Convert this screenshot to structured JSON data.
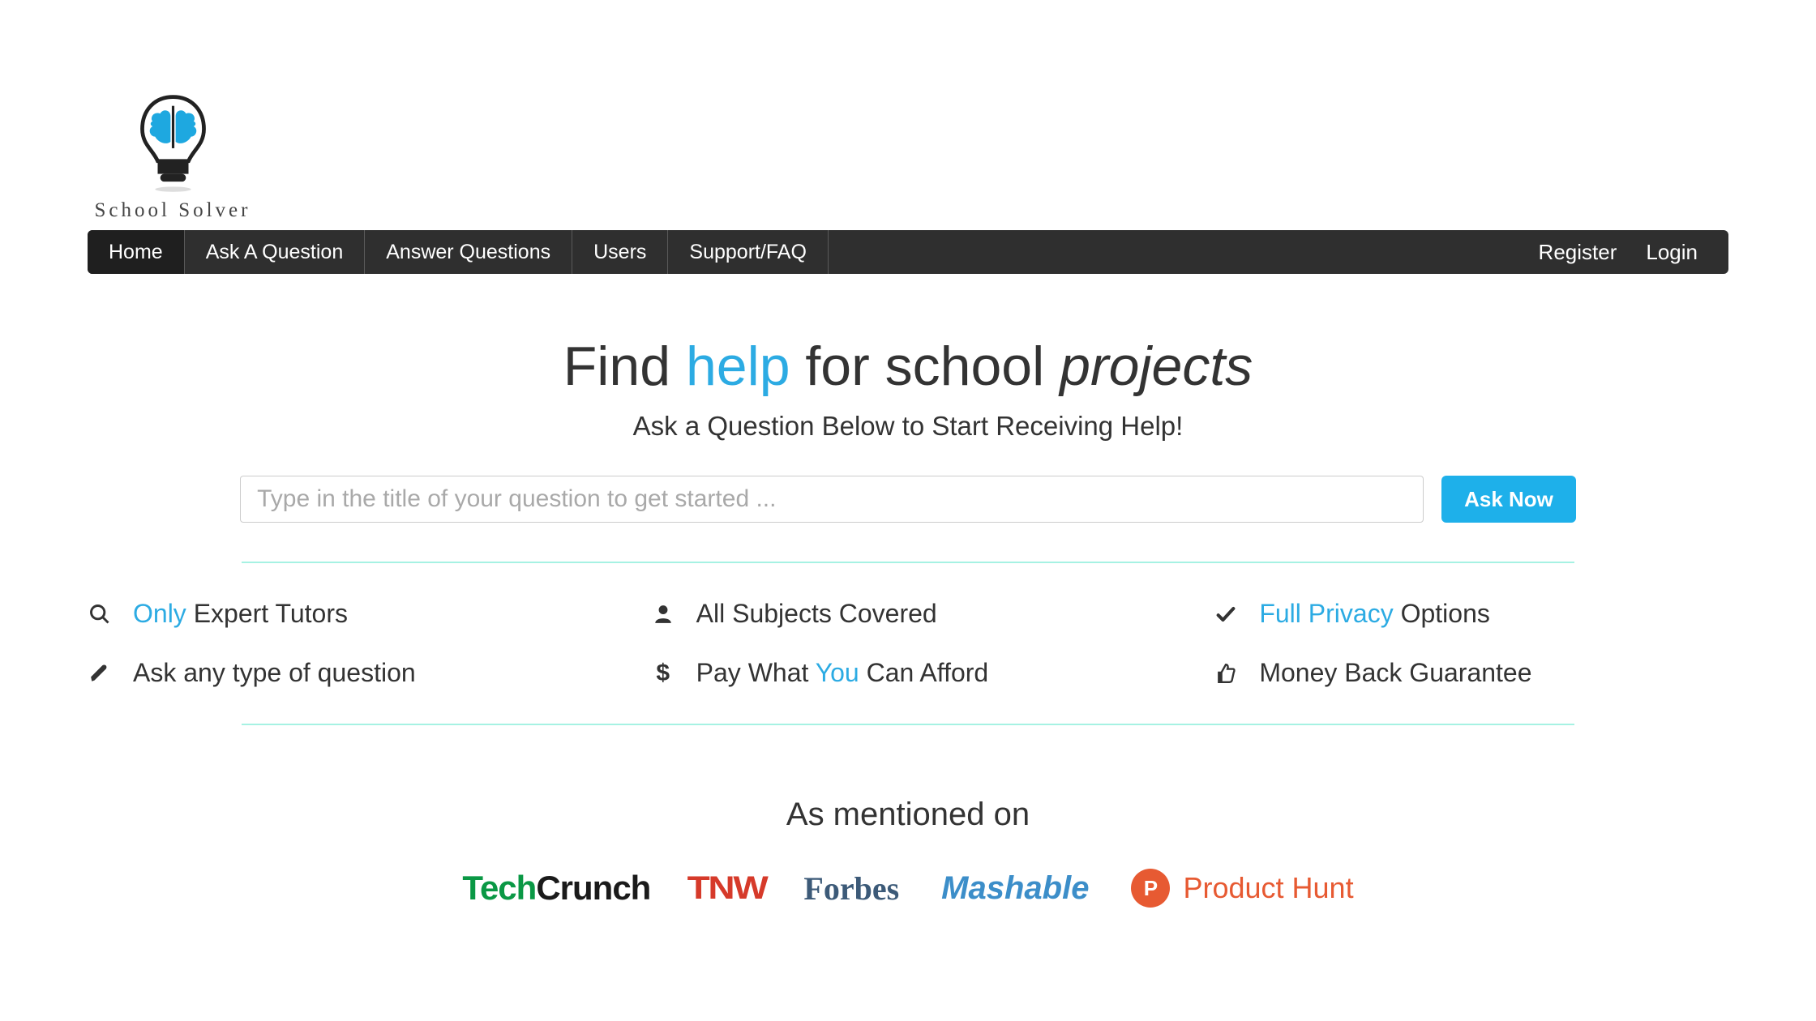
{
  "brand": {
    "name": "School Solver"
  },
  "nav": {
    "items": [
      {
        "label": "Home"
      },
      {
        "label": "Ask A Question"
      },
      {
        "label": "Answer Questions"
      },
      {
        "label": "Users"
      },
      {
        "label": "Support/FAQ"
      }
    ],
    "register": "Register",
    "login": "Login"
  },
  "hero": {
    "title_pre": "Find ",
    "title_accent": "help",
    "title_mid": " for school ",
    "title_italic": "projects",
    "subtitle": "Ask a Question Below to Start Receiving Help!"
  },
  "ask": {
    "placeholder": "Type in the title of your question to get started ...",
    "buttonLabel": "Ask Now"
  },
  "features": [
    {
      "icon": "search",
      "parts": [
        {
          "text": "Only",
          "accent": true
        },
        {
          "text": " Expert Tutors",
          "accent": false
        }
      ]
    },
    {
      "icon": "user",
      "parts": [
        {
          "text": "All Subjects Covered",
          "accent": false
        }
      ]
    },
    {
      "icon": "check",
      "parts": [
        {
          "text": "Full Privacy",
          "accent": true
        },
        {
          "text": " Options",
          "accent": false
        }
      ]
    },
    {
      "icon": "pencil",
      "parts": [
        {
          "text": "Ask any type of question",
          "accent": false
        }
      ]
    },
    {
      "icon": "dollar",
      "parts": [
        {
          "text": "Pay What ",
          "accent": false
        },
        {
          "text": "You",
          "accent": true
        },
        {
          "text": " Can Afford",
          "accent": false
        }
      ]
    },
    {
      "icon": "thumbsup",
      "parts": [
        {
          "text": "Money Back Guarantee",
          "accent": false
        }
      ]
    }
  ],
  "press": {
    "heading": "As mentioned on",
    "techcrunch": {
      "t": "Tech",
      "c": "Crunch"
    },
    "tnw": "TNW",
    "forbes": "Forbes",
    "mashable": "Mashable",
    "producthunt": {
      "p": "P",
      "text": "Product Hunt"
    }
  }
}
